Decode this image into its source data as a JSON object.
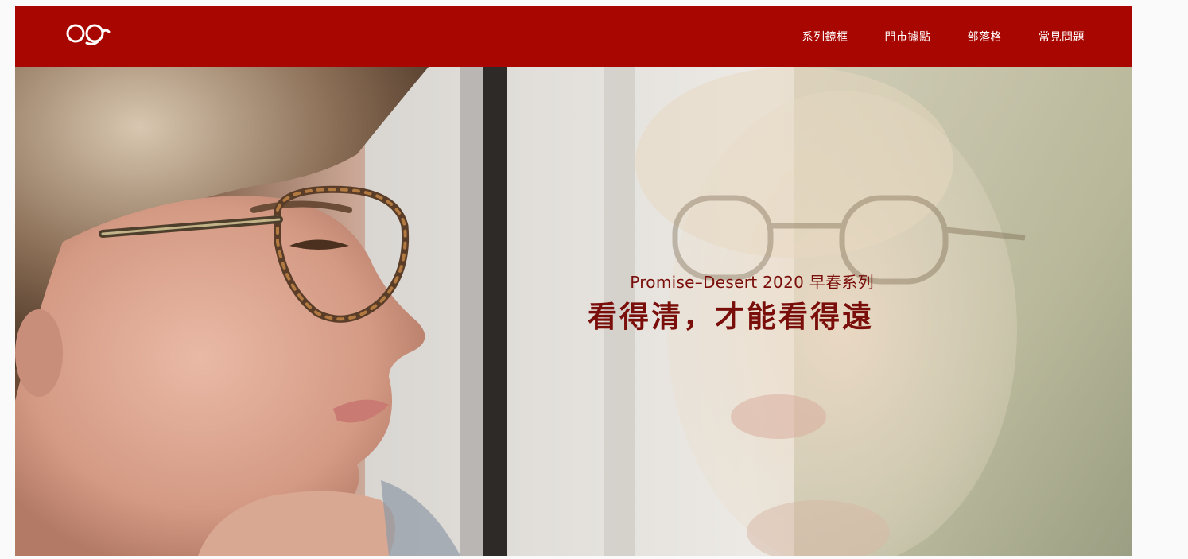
{
  "header": {
    "logo_icon": "glasses-logo-icon",
    "nav": [
      {
        "label": "系列鏡框"
      },
      {
        "label": "門市據點"
      },
      {
        "label": "部落格"
      },
      {
        "label": "常見問題"
      }
    ],
    "background_color": "#a80600"
  },
  "hero": {
    "subtitle": "Promise–Desert 2020 早春系列",
    "title": "看得清，才能看得遠",
    "text_color": "#7a0e0a"
  }
}
